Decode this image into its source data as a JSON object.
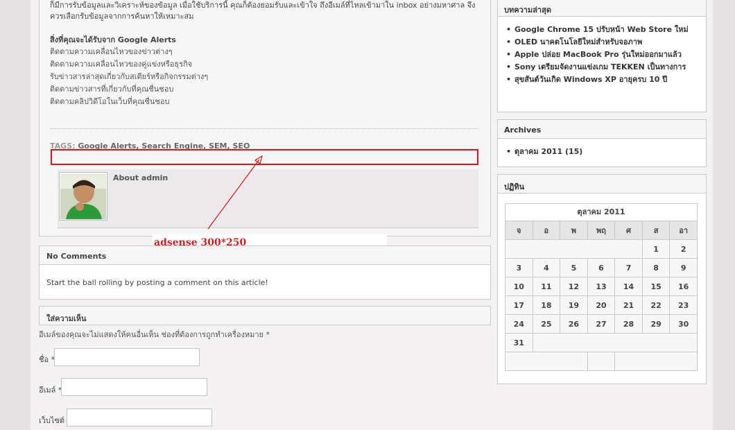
{
  "post": {
    "intro_line1": "ก็มีการรับข้อมูลและวิเคราะห์ของข้อมูล เมื่อใช้บริการนี้ คุณก็ต้องยอมรับและเข้าใจ ถึงอีเมล์ที่ไหลเข้ามาใน inbox อย่างมหาศาล จึง",
    "intro_line2": "ควรเลือกรับข้อมูลจากการค้นหาให้เหมาะสม",
    "alerts_title": "สิ่งที่คุณจะได้รับจาก Google Alerts",
    "alerts_items": [
      "ติดตามความเคลื่อนไหวของข่าวต่างๆ",
      "ติดตามความเคลื่อนไหวของคู่แข่งหรือธุรกิจ",
      "รับข่าวสารล่าสุดเกี่ยวกับสเตียร์หรือกิจกรรมต่างๆ",
      "ติดตามข่าวสารที่เกี่ยวกับที่คุณชื่นชอบ",
      "ติดตามคลิปวิดีโอในเว็บที่คุณชื่นชอบ"
    ],
    "tags_label": "TAGS:",
    "tags_value": "Google Alerts, Search Engine, SEM, SEO",
    "about_name": "About admin"
  },
  "annotation": {
    "ad_label": "adsense 300*250",
    "arrow_color": "#d4141a"
  },
  "comments": {
    "title": "No Comments",
    "empty_text": "Start the ball rolling by posting a comment on this article!"
  },
  "reply": {
    "title": "ใส่ความเห็น",
    "note": "อีเมล์ของคุณจะไม่แสดงให้คนอื่นเห็น ช่องที่ต้องการถูกทำเครื่องหมาย *",
    "name_label": "ชื่อ *",
    "email_label": "อีเมล์ *",
    "website_label": "เว็บไซต์"
  },
  "sidebar": {
    "recent_title": "บทความล่าสุด",
    "recent_posts": [
      "Google Chrome 15 ปรับหน้า Web Store ใหม่",
      "OLED นาคตโนโลยีใหม่สำหรับจอภาพ",
      "Apple ปล่อย MacBook Pro รุ่นใหม่ออกมาแล้ว",
      "Sony เตรียมจัดงานแข่งเกม TEKKEN เป็นทางการ",
      "สุขสันต์วันเกิด Windows XP อายุครบ 10 ปี"
    ],
    "archives_title": "Archives",
    "archives": [
      "ตุลาคม 2011 (15)"
    ],
    "calendar_title": "ปฏิทิน"
  },
  "calendar": {
    "caption": "ตุลาคม 2011",
    "weekdays": [
      "จ",
      "อ",
      "พ",
      "พฤ",
      "ศ",
      "ส",
      "อา"
    ],
    "weeks": [
      [
        "",
        "",
        "",
        "",
        "",
        "1",
        "2"
      ],
      [
        "3",
        "4",
        "5",
        "6",
        "7",
        "8",
        "9"
      ],
      [
        "10",
        "11",
        "12",
        "13",
        "14",
        "15",
        "16"
      ],
      [
        "17",
        "18",
        "19",
        "20",
        "21",
        "22",
        "23"
      ],
      [
        "24",
        "25",
        "26",
        "27",
        "28",
        "29",
        "30"
      ],
      [
        "31",
        "",
        "",
        "",
        "",
        "",
        ""
      ]
    ]
  }
}
